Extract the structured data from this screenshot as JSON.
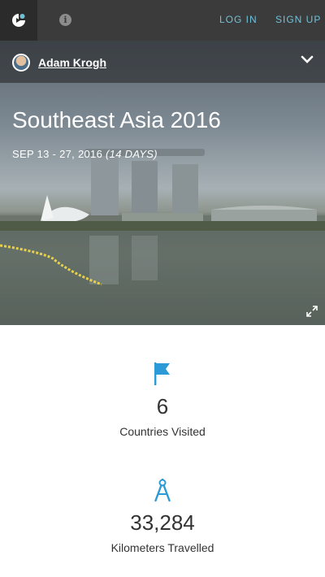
{
  "nav": {
    "login": "LOG IN",
    "signup": "SIGN UP",
    "icons": [
      "app-logo-icon",
      "info-icon"
    ],
    "accent": "#6fc1d8"
  },
  "user": {
    "name": "Adam Krogh"
  },
  "trip": {
    "title": "Southeast Asia 2016",
    "dates": "SEP 13 - 27, 2016",
    "duration": "(14 DAYS)"
  },
  "stats": [
    {
      "icon": "flag-icon",
      "value": "6",
      "label": "Countries Visited"
    },
    {
      "icon": "compass-icon",
      "value": "33,284",
      "label": "Kilometers Travelled"
    }
  ],
  "colors": {
    "stat_icon": "#2c9ad6",
    "topbar": "#3b3b3b"
  }
}
